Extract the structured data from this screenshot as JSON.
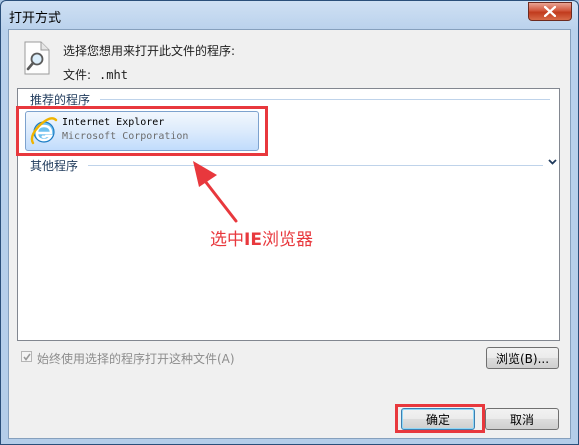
{
  "window": {
    "title": "打开方式"
  },
  "dialog": {
    "prompt": "选择您想用来打开此文件的程序:",
    "file_label": "文件:",
    "file_name": ".mht"
  },
  "recommended": {
    "header": "推荐的程序",
    "programs": [
      {
        "name": "Internet Explorer",
        "vendor": "Microsoft Corporation"
      }
    ]
  },
  "other": {
    "header": "其他程序"
  },
  "annotation": {
    "prefix": "选中",
    "bold": "IE",
    "suffix": "浏览器",
    "color": "#e8383d"
  },
  "options": {
    "always_use": "始终使用选择的程序打开这种文件(A)",
    "always_use_checked": true,
    "always_use_disabled": true
  },
  "buttons": {
    "browse": "浏览(B)...",
    "ok": "确定",
    "cancel": "取消"
  },
  "icons": {
    "close": "close-icon",
    "document": "document-search-icon",
    "program": "internet-explorer-icon",
    "expand": "chevron-down-icon"
  }
}
